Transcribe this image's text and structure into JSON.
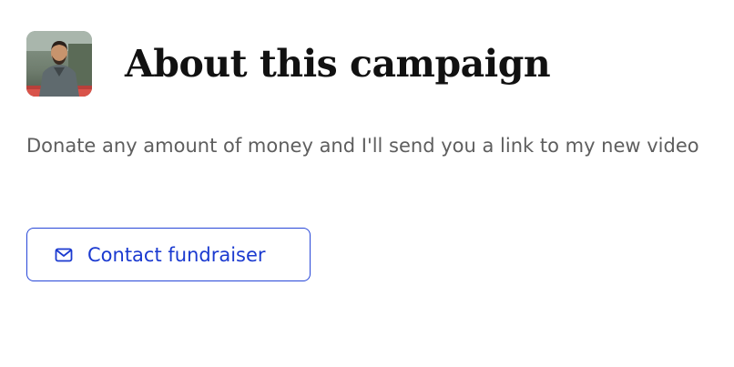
{
  "campaign": {
    "title": "About this campaign",
    "description": "Donate any amount of money and I'll send you a link to my new video",
    "contact_button": {
      "label": "Contact fundraiser",
      "icon": "mail-icon"
    },
    "avatar": {
      "icon": "organizer-avatar"
    }
  },
  "colors": {
    "title": "#111111",
    "description": "#5e5e5e",
    "accent": "#2747d8"
  }
}
